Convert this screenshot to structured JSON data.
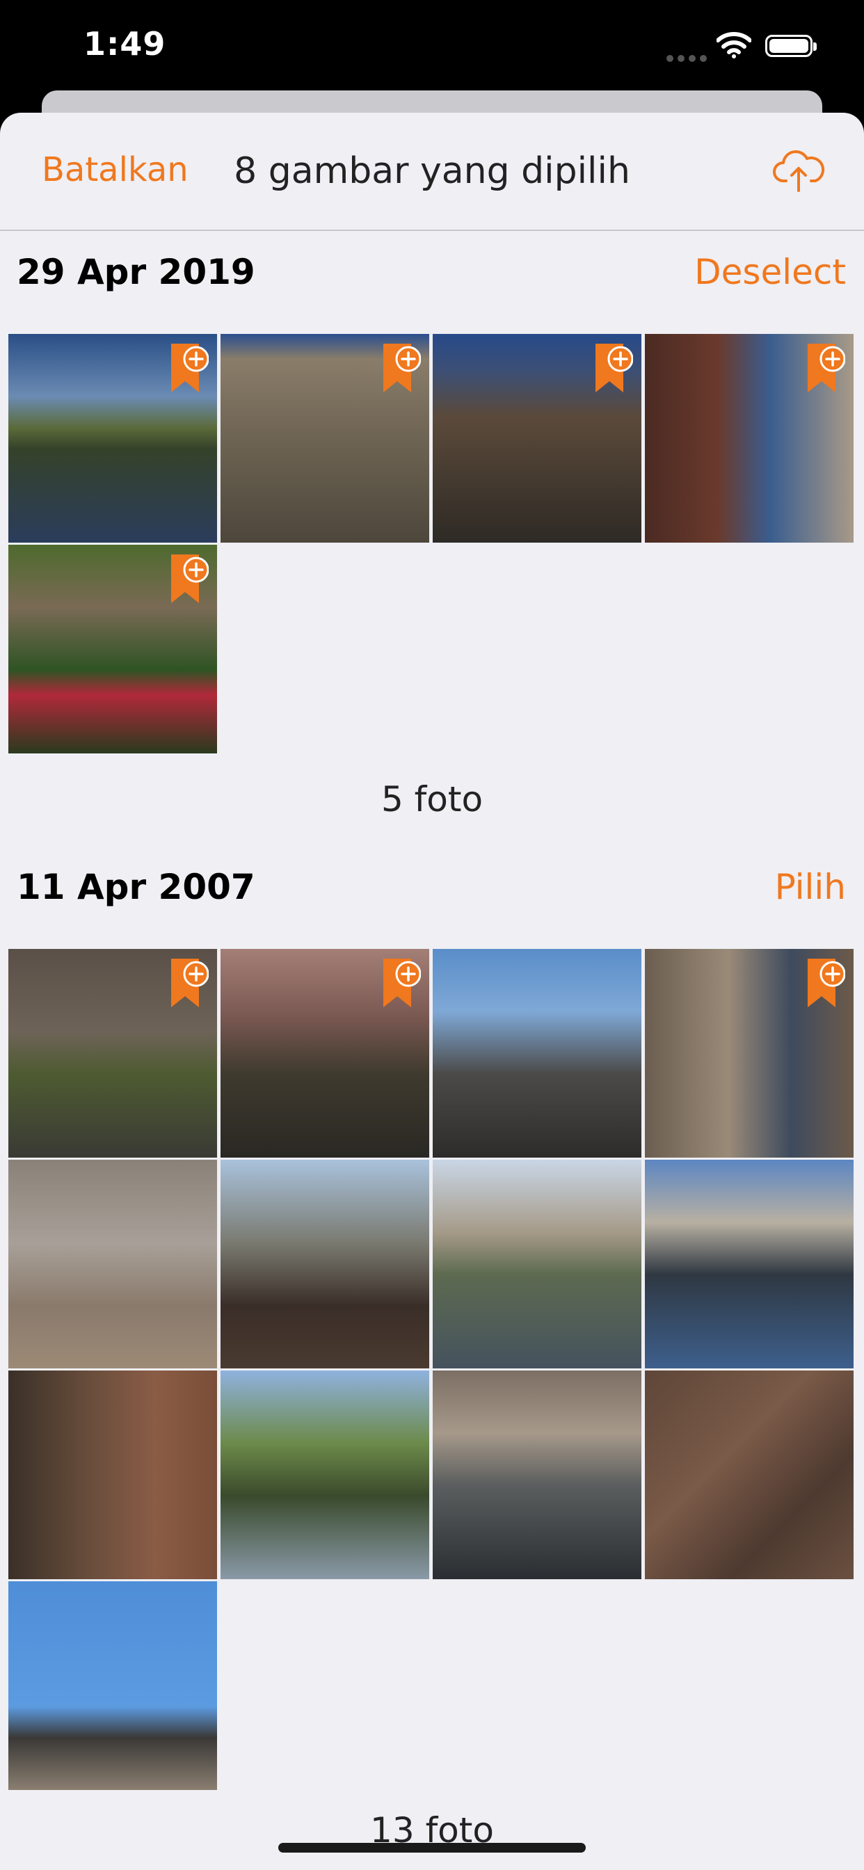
{
  "status_bar": {
    "time": "1:49"
  },
  "nav": {
    "cancel_label": "Batalkan",
    "title": "8 gambar yang dipilih",
    "upload_icon": "cloud-upload-icon"
  },
  "accent_color": "#f0781e",
  "sections": [
    {
      "date": "29 Apr 2019",
      "action": "Deselect",
      "count_label": "5 foto",
      "photos": [
        {
          "subject": "canal-street",
          "selected": true
        },
        {
          "subject": "classical-building",
          "selected": true
        },
        {
          "subject": "ornate-town-hall",
          "selected": true
        },
        {
          "subject": "narrow-canal-street",
          "selected": true
        },
        {
          "subject": "garden-tulips",
          "selected": true
        }
      ]
    },
    {
      "date": "11 Apr 2007",
      "action": "Pilih",
      "count_label": "13 foto",
      "photos": [
        {
          "subject": "church-canal-bridge",
          "selected": true
        },
        {
          "subject": "blossom-canal",
          "selected": true
        },
        {
          "subject": "gabled-roof",
          "selected": false
        },
        {
          "subject": "canal-awnings",
          "selected": true
        },
        {
          "subject": "square-cafe",
          "selected": false
        },
        {
          "subject": "bare-trees-railing",
          "selected": false
        },
        {
          "subject": "canal-bridge-spring",
          "selected": false
        },
        {
          "subject": "canal-boat",
          "selected": false
        },
        {
          "subject": "bicycle-brick-wall",
          "selected": false
        },
        {
          "subject": "long-canal-trees",
          "selected": false
        },
        {
          "subject": "canal-reflection-bikes",
          "selected": false
        },
        {
          "subject": "duck-on-bricks",
          "selected": false
        },
        {
          "subject": "church-tower-sky",
          "selected": false
        }
      ]
    }
  ]
}
